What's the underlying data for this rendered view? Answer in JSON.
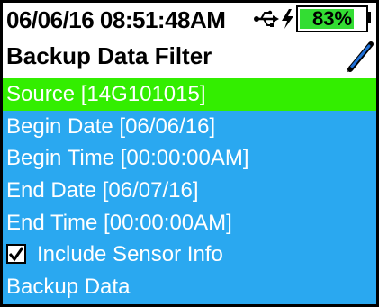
{
  "status": {
    "datetime": "06/06/16  08:51:48AM",
    "usb_icon": "usb-icon",
    "charging_icon": "lightning-bolt-icon",
    "battery_label": "83%",
    "battery_level": 0.83,
    "battery_fill_color": "#33dd33"
  },
  "header": {
    "title": "Backup Data Filter",
    "pen_icon": "pen-icon"
  },
  "menu": {
    "background": "#2aa8f0",
    "selected_color": "#33ee00",
    "items": [
      {
        "label": "Source [14G101015]",
        "selected": true
      },
      {
        "label": "Begin Date [06/06/16]"
      },
      {
        "label": "Begin Time [00:00:00AM]"
      },
      {
        "label": "End Date [06/07/16]"
      },
      {
        "label": "End Time [00:00:00AM]"
      },
      {
        "label": "Include Sensor Info",
        "checked": true
      },
      {
        "label": "Backup Data"
      }
    ]
  }
}
